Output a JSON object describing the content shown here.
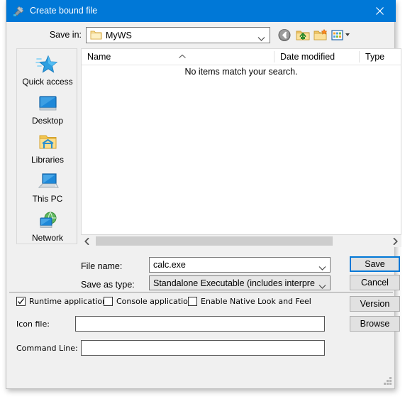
{
  "window": {
    "title": "Create bound file",
    "title_icon": "bound-file-icon",
    "close_label": "✕",
    "accent_color": "#0078d7",
    "face_color": "#f0f0f0"
  },
  "savein": {
    "label": "Save in:",
    "value": "MyWS",
    "icon": "folder-icon",
    "chevron": "chevron-down-icon"
  },
  "toolbar": {
    "back": "back-arrow-icon",
    "up": "up-one-level-icon",
    "new_folder": "new-folder-icon",
    "views": "views-icon"
  },
  "places": [
    {
      "label": "Quick access",
      "icon": "star-icon"
    },
    {
      "label": "Desktop",
      "icon": "monitor-icon"
    },
    {
      "label": "Libraries",
      "icon": "libraries-folder-icon"
    },
    {
      "label": "This PC",
      "icon": "laptop-icon"
    },
    {
      "label": "Network",
      "icon": "network-globe-icon"
    }
  ],
  "filelist": {
    "columns": [
      "Name",
      "Date modified",
      "Type"
    ],
    "sort_column": "Name",
    "sort_direction": "ascending",
    "rows": [],
    "empty_message": "No items match your search."
  },
  "scrollbar": {
    "left_arrow": "‹",
    "right_arrow": "›"
  },
  "filename": {
    "label": "File name:",
    "value": "calc.exe"
  },
  "savetype": {
    "label": "Save as type:",
    "value": "Standalone Executable (includes interpreter exe"
  },
  "buttons": {
    "save": "Save",
    "cancel": "Cancel",
    "version": "Version",
    "browse": "Browse"
  },
  "options": [
    {
      "label": "Runtime application",
      "checked": true
    },
    {
      "label": "Console application",
      "checked": false
    },
    {
      "label": "Enable Native Look and Feel",
      "checked": false
    }
  ],
  "fields": {
    "iconfile_label": "Icon file:",
    "iconfile_value": "",
    "cmdline_label": "Command Line:",
    "cmdline_value": ""
  }
}
